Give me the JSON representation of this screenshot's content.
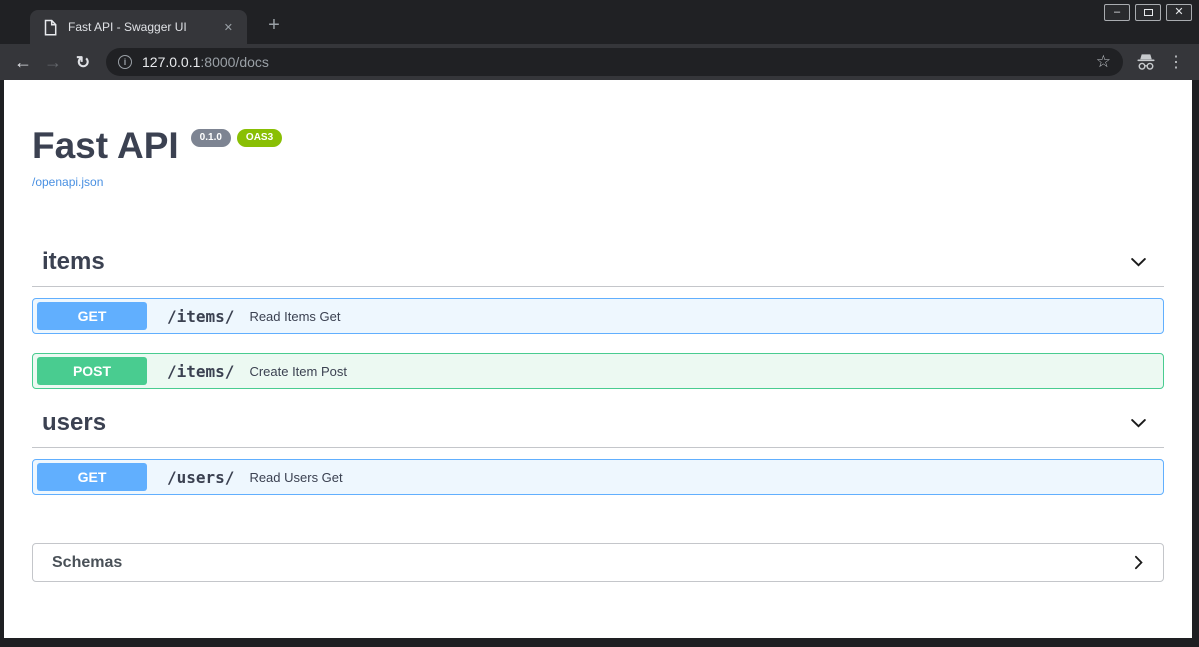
{
  "window": {
    "controls": {
      "minimize_glyph": "–",
      "close_glyph": "✕"
    }
  },
  "browser": {
    "tab_title": "Fast API - Swagger UI",
    "tab_close_glyph": "✕",
    "new_tab_glyph": "+",
    "nav": {
      "back_glyph": "←",
      "forward_glyph": "→",
      "reload_glyph": "↻"
    },
    "address": {
      "info_glyph": "i",
      "host": "127.0.0.1",
      "path": ":8000/docs"
    },
    "actions": {
      "bookmark_glyph": "☆",
      "menu_glyph": "⋮"
    }
  },
  "api": {
    "title": "Fast API",
    "version_badge": "0.1.0",
    "oas_badge": "OAS3",
    "spec_link": "/openapi.json",
    "sections": [
      {
        "name": "items",
        "operations": [
          {
            "method": "GET",
            "path": "/items/",
            "summary": "Read Items Get"
          },
          {
            "method": "POST",
            "path": "/items/",
            "summary": "Create Item Post"
          }
        ]
      },
      {
        "name": "users",
        "operations": [
          {
            "method": "GET",
            "path": "/users/",
            "summary": "Read Users Get"
          }
        ]
      }
    ],
    "schemas": {
      "label": "Schemas"
    }
  },
  "colors": {
    "get": "#61affe",
    "post": "#49cc90",
    "get_row_bg": "#eef7fe",
    "post_row_bg": "#ecf9f2",
    "heading": "#3b4151",
    "link": "#4990e2",
    "version_badge_bg": "#7d8492",
    "oas_badge_bg": "#89bf04",
    "toolbar_bg": "#35363a",
    "frame_bg": "#202124"
  }
}
